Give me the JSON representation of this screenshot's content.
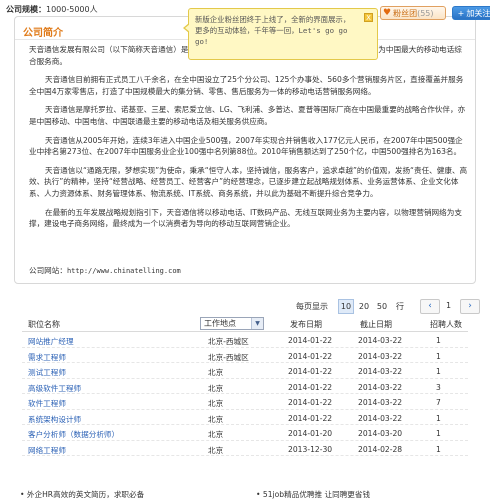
{
  "header": {
    "scale_label": "公司规模：",
    "scale_value": "1000-5000人"
  },
  "card": {
    "title": "公司简介",
    "fans_label": "粉丝团",
    "fans_count": "(55)",
    "follow_label": "加关注"
  },
  "tooltip": {
    "line1": "新版企业粉丝团终于上线了，全新的界面展示，",
    "line2": "更多的互动体验，千年等一回，",
    "line2_mono": "Let's go go",
    "line3": "go!",
    "close": "X"
  },
  "intro": {
    "p1": "天音通信发展有限公司（以下简称天音通信）是……………………………………………………………已成为中国最大的移动电话综合服务商。",
    "p2": "天音通信目前拥有正式员工八千余名，在全中国设立了25个分公司、125个办事处、560多个营销服务片区，直接覆盖并服务全中国4万家零售店，打造了中国规模最大的集分销、零售、售后服务为一体的移动电话营销服务网络。",
    "p3": "天音通信是摩托罗拉、诺基亚、三星、索尼爱立信、LG、飞利浦、多普达、夏普等国际厂商在中国最重要的战略合作伙伴，亦是中国移动、中国电信、中国联通最主要的移动电话及相关服务供应商。",
    "p4": "天音通信从2005年开始，连续3年进入中国企业500强，2007年实现合并销售收入177亿元人民币，在2007年中国500强企业中排名第273位、在2007年中国服务业企业100强中名列第88位。2010年销售额达到了250个亿，中国500强排名为163名。",
    "p5": "天音通信以“通路无限，梦想实现”为使命，秉承“恒守人本，坚持诚信，服务客户，追求卓越”的价值观，发扬“责任、健康、高效、执行”的精神，坚持“经营战略、经营员工、经营客户”的经营理念，已逐步建立起战略规划体系、业务运营体系、企业文化体系、人力资源体系、财务管理体系、物流系统、IT系统、商务系统，并以此为基础不断提升综合竞争力。",
    "p6": "在最新的五年发展战略规划指引下，天音通信将以移动电话、IT数码产品、无线互联网业务为主要内容，以物理营销网络为支撑，建设电子商务网络，最终成为一个以消费者为导向的移动互联网营销企业。",
    "site_label": "公司网站：",
    "site_url": "http://www.chinatelling.com"
  },
  "pager": {
    "per_page_label": "每页显示",
    "options": [
      "10",
      "20",
      "50"
    ],
    "active": "10",
    "rows_unit": "行",
    "prev": "‹",
    "page": "1",
    "next": "›"
  },
  "table": {
    "headers": {
      "position": "职位名称",
      "location_select": "工作地点",
      "publish": "发布日期",
      "deadline": "截止日期",
      "count": "招聘人数"
    },
    "rows": [
      {
        "position": "网站推广经理",
        "location": "北京-西城区",
        "publish": "2014-01-22",
        "deadline": "2014-03-22",
        "count": "1"
      },
      {
        "position": "需求工程师",
        "location": "北京-西城区",
        "publish": "2014-01-22",
        "deadline": "2014-03-22",
        "count": "1"
      },
      {
        "position": "测试工程师",
        "location": "北京",
        "publish": "2014-01-22",
        "deadline": "2014-03-22",
        "count": "1"
      },
      {
        "position": "高级软件工程师",
        "location": "北京",
        "publish": "2014-01-22",
        "deadline": "2014-03-22",
        "count": "3"
      },
      {
        "position": "软件工程师",
        "location": "北京",
        "publish": "2014-01-22",
        "deadline": "2014-03-22",
        "count": "7"
      },
      {
        "position": "系统架构设计师",
        "location": "北京",
        "publish": "2014-01-22",
        "deadline": "2014-03-22",
        "count": "1"
      },
      {
        "position": "客户分析师（数据分析师）",
        "location": "北京",
        "publish": "2014-01-20",
        "deadline": "2014-03-20",
        "count": "1"
      },
      {
        "position": "网络工程师",
        "location": "北京",
        "publish": "2013-12-30",
        "deadline": "2014-02-28",
        "count": "1"
      }
    ]
  },
  "footer": {
    "left": "• 外企HR高效的英文简历，求职必备",
    "right": "• 51job精品优聘推  让同聘更省钱"
  }
}
